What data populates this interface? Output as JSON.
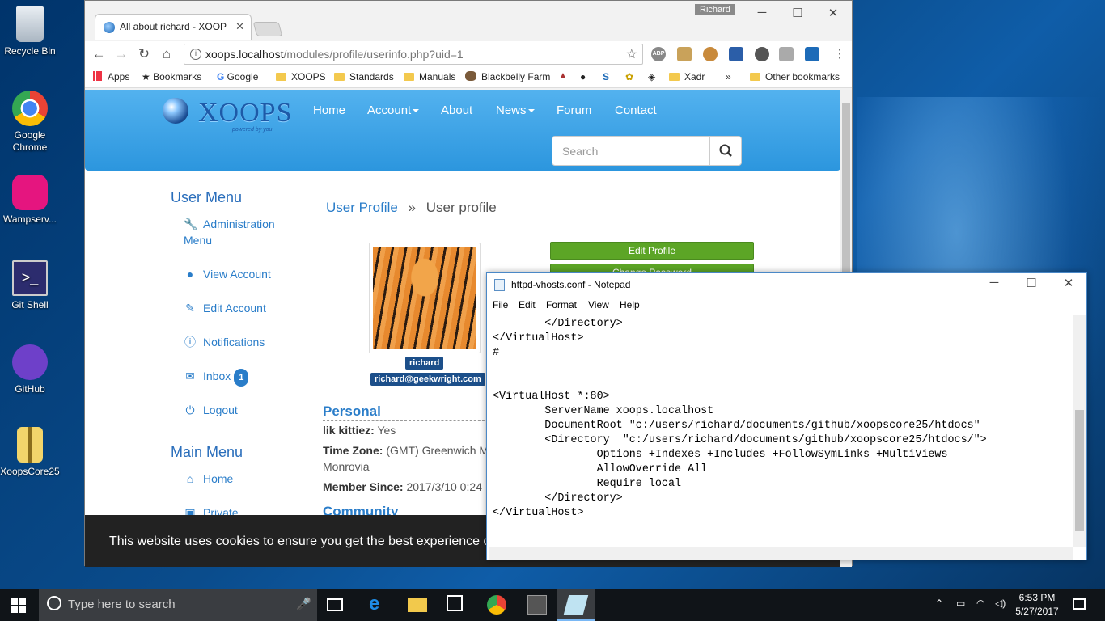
{
  "desktop": {
    "icons": [
      {
        "label": "Recycle Bin",
        "icon": "recycle-bin-icon"
      },
      {
        "label": "Google\nChrome",
        "icon": "chrome-icon"
      },
      {
        "label": "Wampserv...",
        "icon": "wampserver-icon"
      },
      {
        "label": "Git Shell",
        "icon": "git-shell-icon"
      },
      {
        "label": "GitHub",
        "icon": "github-icon"
      },
      {
        "label": "XoopsCore25",
        "icon": "zip-folder-icon"
      }
    ]
  },
  "browser": {
    "tab_title": "All about richard - XOOP",
    "profile_name": "Richard",
    "url_host": "xoops.localhost",
    "url_path": "/modules/profile/userinfo.php?uid=1",
    "extensions": [
      "ABP"
    ],
    "bookmarks": {
      "apps": "Apps",
      "bookmarks": "Bookmarks",
      "google": "Google",
      "xoops": "XOOPS",
      "standards": "Standards",
      "manuals": "Manuals",
      "blackbelly": "Blackbelly Farm",
      "xadr": "Xadr",
      "more": "»",
      "other": "Other bookmarks"
    }
  },
  "site": {
    "logo": "XOOPS",
    "logo_sub": "powered by you",
    "nav": {
      "home": "Home",
      "account": "Account",
      "about": "About",
      "news": "News",
      "forum": "Forum",
      "contact": "Contact"
    },
    "search_placeholder": "Search",
    "user_menu_title": "User Menu",
    "user_menu": {
      "admin": "Administration",
      "admin2": "Menu",
      "view": "View Account",
      "edit": "Edit Account",
      "notif": "Notifications",
      "inbox": "Inbox",
      "inbox_count": "1",
      "logout": "Logout"
    },
    "main_menu_title": "Main Menu",
    "main_menu": {
      "home": "Home",
      "private": "Private"
    },
    "breadcrumb": {
      "link": "User Profile",
      "sep": "»",
      "current": "User profile"
    },
    "username": "richard",
    "email": "richard@geekwright.com",
    "buttons": {
      "edit_profile": "Edit Profile",
      "change_password": "Change Password"
    },
    "personal_title": "Personal",
    "fields": {
      "kitties_label": "lik kittiez:",
      "kitties_value": "Yes",
      "tz_label": "Time Zone:",
      "tz_value": "(GMT) Greenwich M",
      "tz_value2": "Monrovia",
      "since_label": "Member Since:",
      "since_value": "2017/3/10 0:24"
    },
    "community_title": "Community",
    "cookie_text": "This website uses cookies to ensure you get the best experience on"
  },
  "notepad": {
    "title": "httpd-vhosts.conf - Notepad",
    "menu": {
      "file": "File",
      "edit": "Edit",
      "format": "Format",
      "view": "View",
      "help": "Help"
    },
    "text": "        </Directory>\n</VirtualHost>\n#\n\n\n<VirtualHost *:80>\n        ServerName xoops.localhost\n        DocumentRoot \"c:/users/richard/documents/github/xoopscore25/htdocs\"\n        <Directory  \"c:/users/richard/documents/github/xoopscore25/htdocs/\">\n                Options +Indexes +Includes +FollowSymLinks +MultiViews\n                AllowOverride All\n                Require local\n        </Directory>\n</VirtualHost>"
  },
  "taskbar": {
    "search_placeholder": "Type here to search",
    "time": "6:53 PM",
    "date": "5/27/2017"
  }
}
